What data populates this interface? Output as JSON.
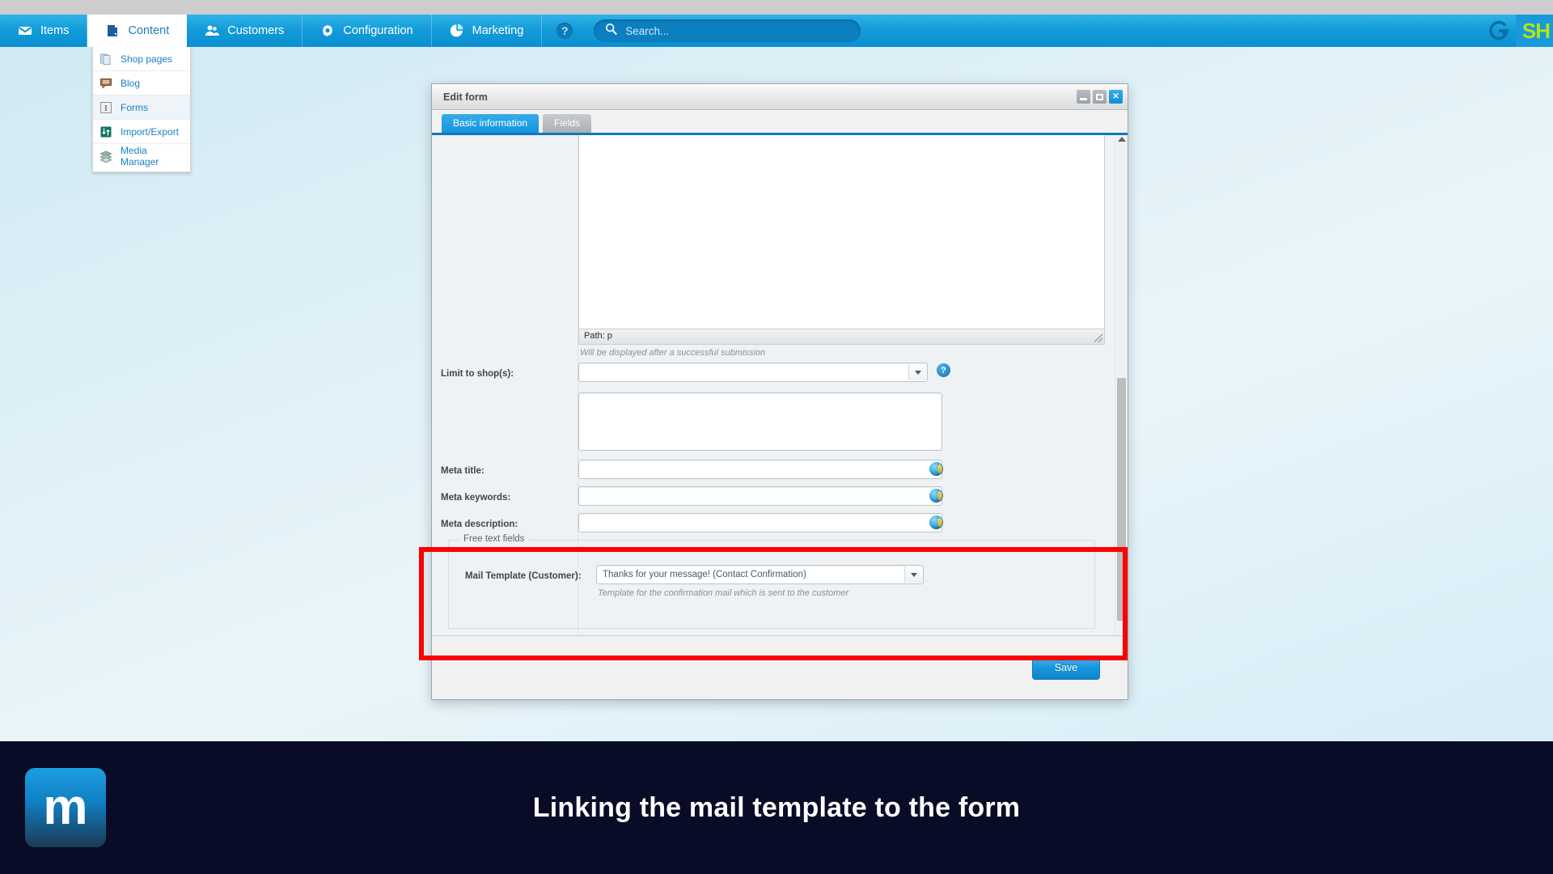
{
  "topnav": {
    "items": [
      {
        "label": "Items",
        "icon": "inbox-icon",
        "active": false
      },
      {
        "label": "Content",
        "icon": "document-icon",
        "active": true
      },
      {
        "label": "Customers",
        "icon": "people-icon",
        "active": false
      },
      {
        "label": "Configuration",
        "icon": "gear-icon",
        "active": false
      },
      {
        "label": "Marketing",
        "icon": "pie-chart-icon",
        "active": false
      }
    ],
    "help_icon": "question-mark-icon",
    "brand_word": "SH",
    "brand_icon": "shopware-logo-icon"
  },
  "search": {
    "placeholder": "Search...",
    "value": "",
    "icon": "search-icon"
  },
  "content_menu": {
    "items": [
      {
        "label": "Shop pages",
        "icon": "pages-icon",
        "highlighted": false
      },
      {
        "label": "Blog",
        "icon": "speech-bubble-icon",
        "highlighted": false
      },
      {
        "label": "Forms",
        "icon": "form-field-icon",
        "highlighted": true
      },
      {
        "label": "Import/Export",
        "icon": "transfer-icon",
        "highlighted": false
      },
      {
        "label": "Media Manager",
        "icon": "layers-icon",
        "highlighted": false
      }
    ]
  },
  "modal": {
    "title": "Edit form",
    "window_controls": {
      "minimize": "minimize-icon",
      "maximize": "maximize-icon",
      "close": "close-icon"
    },
    "tabs": [
      {
        "label": "Basic information",
        "selected": true
      },
      {
        "label": "Fields",
        "selected": false
      }
    ],
    "editor": {
      "content": "",
      "status_path": "Path: p",
      "hint": "Will be displayed after a successful submission"
    },
    "fields": [
      {
        "label": "Limit to shop(s):",
        "value": "",
        "type": "select",
        "has_help": true
      },
      {
        "label": "",
        "value": "",
        "type": "listbox"
      },
      {
        "label": "Meta title:",
        "value": "",
        "type": "text",
        "translate_icon": "globe-icon"
      },
      {
        "label": "Meta keywords:",
        "value": "",
        "type": "text",
        "translate_icon": "globe-icon"
      },
      {
        "label": "Meta description:",
        "value": "",
        "type": "text",
        "translate_icon": "globe-icon"
      }
    ],
    "fieldset": {
      "legend": "Free text fields",
      "row": {
        "label": "Mail Template (Customer):",
        "value": "Thanks for your message! (Contact Confirmation)",
        "hint": "Template for the confirmation mail which is sent to the customer"
      }
    },
    "footer": {
      "save_label": "Save"
    }
  },
  "annotation": {
    "highlight_color": "#ff0000"
  },
  "banner": {
    "logo_letter": "m",
    "caption": "Linking the mail template to the form"
  }
}
